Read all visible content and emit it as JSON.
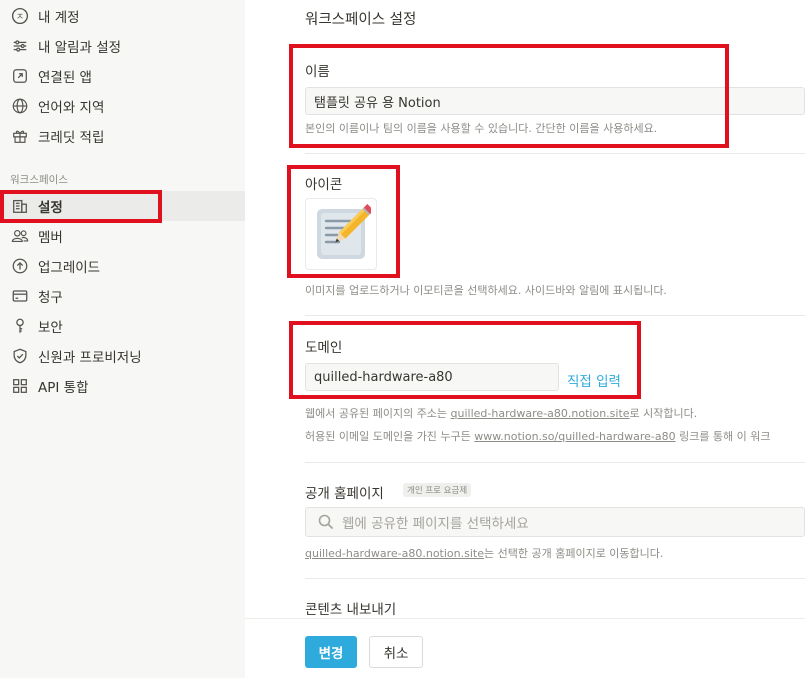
{
  "sidebar": {
    "account_items": [
      {
        "label": "내 계정",
        "icon": "account-circle-icon"
      },
      {
        "label": "내 알림과 설정",
        "icon": "sliders-icon"
      },
      {
        "label": "연결된 앱",
        "icon": "external-link-icon"
      },
      {
        "label": "언어와 지역",
        "icon": "globe-icon"
      },
      {
        "label": "크레딧 적립",
        "icon": "gift-icon"
      }
    ],
    "workspace_section_label": "워크스페이스",
    "workspace_items": [
      {
        "label": "설정",
        "icon": "building-icon",
        "active": true
      },
      {
        "label": "멤버",
        "icon": "people-icon"
      },
      {
        "label": "업그레이드",
        "icon": "arrow-up-circle-icon"
      },
      {
        "label": "청구",
        "icon": "credit-card-icon"
      },
      {
        "label": "보안",
        "icon": "key-icon"
      },
      {
        "label": "신원과 프로비저닝",
        "icon": "shield-check-icon"
      },
      {
        "label": "API 통합",
        "icon": "grid-icon"
      }
    ]
  },
  "main": {
    "title": "워크스페이스 설정",
    "name": {
      "label": "이름",
      "value": "탬플릿 공유 용 Notion",
      "help": "본인의 이름이나 팀의 이름을 사용할 수 있습니다. 간단한 이름을 사용하세요."
    },
    "icon": {
      "label": "아이콘",
      "value_icon": "pencil-memo-icon",
      "help": "이미지를 업로드하거나 이모티콘을 선택하세요. 사이드바와 알림에 표시됩니다."
    },
    "domain": {
      "label": "도메인",
      "value": "quilled-hardware-a80",
      "action": "직접 입력",
      "help1_prefix": "웹에서 공유된 페이지의 주소는 ",
      "help1_link": "quilled-hardware-a80.notion.site",
      "help1_suffix": "로 시작합니다.",
      "help2_prefix": "허용된 이메일 도메인을 가진 누구든 ",
      "help2_link": "www.notion.so/quilled-hardware-a80",
      "help2_suffix": " 링크를 통해 이 워크"
    },
    "public_home": {
      "label": "공개 홈페이지",
      "badge": "개인 프로 요금제",
      "placeholder": "웹에 공유한 페이지를 선택하세요",
      "help_link": "quilled-hardware-a80.notion.site",
      "help_suffix": "는 선택한 공개 홈페이지로 이동합니다."
    },
    "export": {
      "label": "콘텐츠 내보내기"
    }
  },
  "footer": {
    "save": "변경",
    "cancel": "취소"
  },
  "colors": {
    "accent": "#2eaadc",
    "annotation": "#e0101e",
    "sidebar_bg": "#f7f7f5"
  }
}
